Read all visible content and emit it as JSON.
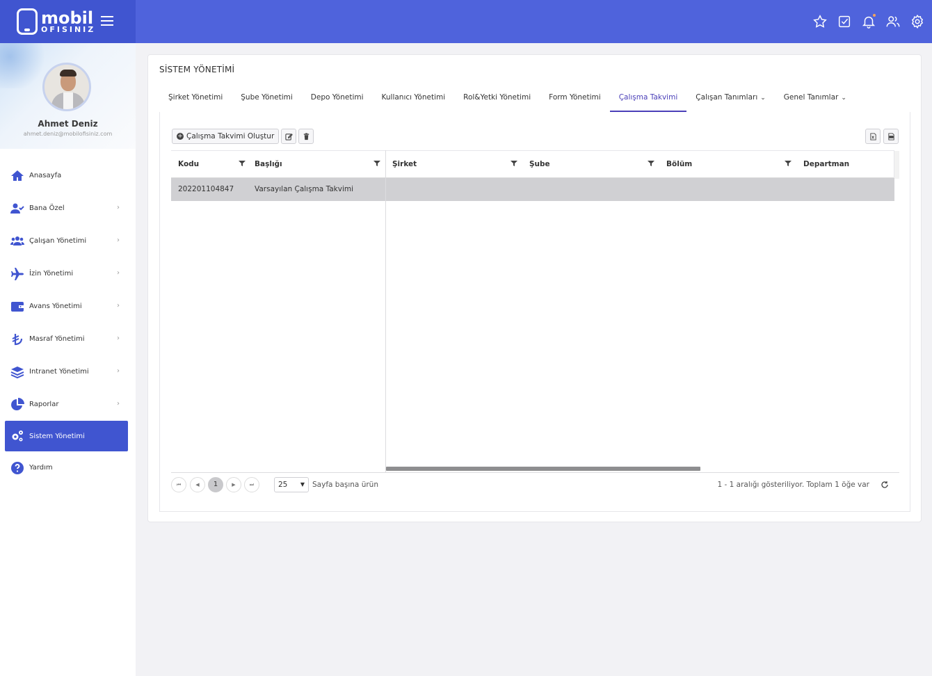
{
  "brand": {
    "line1": "mobil",
    "line2": "OFISINIZ"
  },
  "colors": {
    "topbar": "#4f63dc",
    "active_nav": "#4055d0",
    "active_tab": "#4a3fb8"
  },
  "header_icons": [
    "star-icon",
    "check-square-icon",
    "bell-icon",
    "users-icon",
    "gear-icon"
  ],
  "profile": {
    "name": "Ahmet Deniz",
    "email": "ahmet.deniz@mobilofisiniz.com"
  },
  "sidebar": {
    "items": [
      {
        "label": "Anasayfa",
        "icon": "home-icon"
      },
      {
        "label": "Bana Özel",
        "icon": "user-check-icon"
      },
      {
        "label": "Çalışan Yönetimi",
        "icon": "users-icon"
      },
      {
        "label": "İzin Yönetimi",
        "icon": "plane-icon"
      },
      {
        "label": "Avans Yönetimi",
        "icon": "wallet-icon"
      },
      {
        "label": "Masraf Yönetimi",
        "icon": "lira-icon"
      },
      {
        "label": "Intranet Yönetimi",
        "icon": "layers-icon"
      },
      {
        "label": "Raporlar",
        "icon": "pie-chart-icon"
      },
      {
        "label": "Sistem Yönetimi",
        "icon": "cogs-icon"
      },
      {
        "label": "Yardım",
        "icon": "question-icon"
      }
    ]
  },
  "page": {
    "title": "SİSTEM YÖNETİMİ"
  },
  "tabs": [
    {
      "label": "Şirket Yönetimi"
    },
    {
      "label": "Şube Yönetimi"
    },
    {
      "label": "Depo Yönetimi"
    },
    {
      "label": "Kullanıcı Yönetimi"
    },
    {
      "label": "Rol&Yetki Yönetimi"
    },
    {
      "label": "Form Yönetimi"
    },
    {
      "label": "Çalışma Takvimi"
    },
    {
      "label": "Çalışan Tanımları"
    },
    {
      "label": "Genel Tanımlar"
    }
  ],
  "toolbar": {
    "create_label": "Çalışma Takvimi Oluştur"
  },
  "table": {
    "columns": [
      "Kodu",
      "Başlığı",
      "Şirket",
      "Şube",
      "Bölüm",
      "Departman"
    ],
    "rows": [
      {
        "kodu": "202201104847",
        "basligi": "Varsayılan Çalışma Takvimi",
        "sirket": "",
        "sube": "",
        "bolum": "",
        "departman": ""
      }
    ]
  },
  "pager": {
    "current_page": "1",
    "page_size": "25",
    "page_size_label": "Sayfa başına ürün",
    "info": "1 - 1 aralığı gösteriliyor. Toplam 1 öğe var"
  }
}
